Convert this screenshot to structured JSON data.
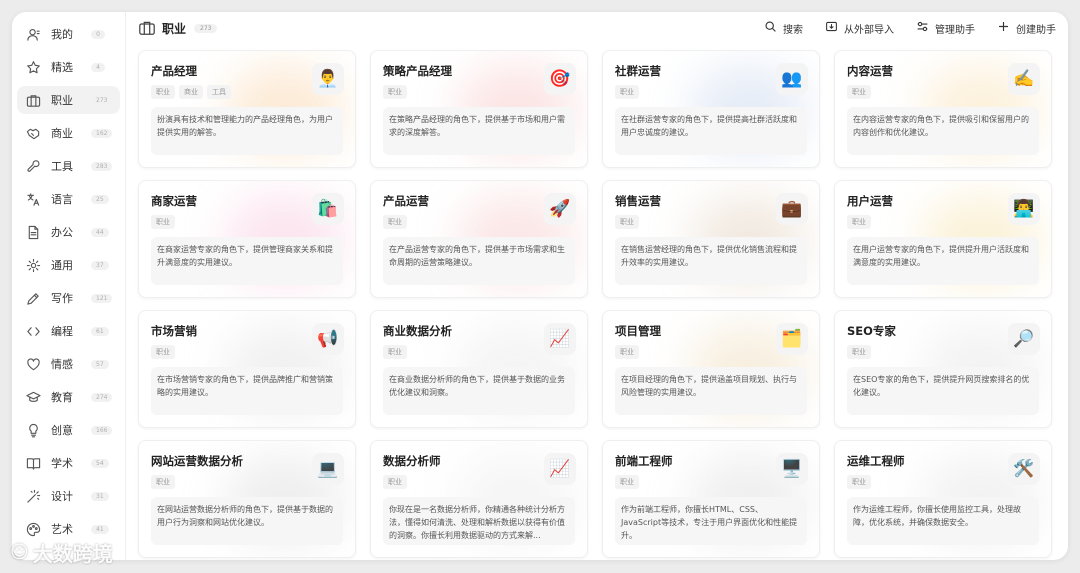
{
  "sidebar": {
    "items": [
      {
        "label": "我的",
        "count": "0",
        "icon": "user-icon"
      },
      {
        "label": "精选",
        "count": "4",
        "icon": "star-icon"
      },
      {
        "label": "职业",
        "count": "273",
        "icon": "briefcase-icon",
        "active": true
      },
      {
        "label": "商业",
        "count": "162",
        "icon": "handshake-icon"
      },
      {
        "label": "工具",
        "count": "283",
        "icon": "wrench-icon"
      },
      {
        "label": "语言",
        "count": "25",
        "icon": "translate-icon"
      },
      {
        "label": "办公",
        "count": "44",
        "icon": "document-icon"
      },
      {
        "label": "通用",
        "count": "37",
        "icon": "gear-icon"
      },
      {
        "label": "写作",
        "count": "121",
        "icon": "pen-icon"
      },
      {
        "label": "编程",
        "count": "61",
        "icon": "code-icon"
      },
      {
        "label": "情感",
        "count": "57",
        "icon": "heart-icon"
      },
      {
        "label": "教育",
        "count": "274",
        "icon": "graduation-icon"
      },
      {
        "label": "创意",
        "count": "166",
        "icon": "lightbulb-icon"
      },
      {
        "label": "学术",
        "count": "54",
        "icon": "book-icon"
      },
      {
        "label": "设计",
        "count": "31",
        "icon": "magic-wand-icon"
      },
      {
        "label": "艺术",
        "count": "41",
        "icon": "palette-icon"
      }
    ]
  },
  "header": {
    "title": "职业",
    "count": "273",
    "actions": [
      {
        "label": "搜索",
        "icon": "search-icon"
      },
      {
        "label": "从外部导入",
        "icon": "import-icon"
      },
      {
        "label": "管理助手",
        "icon": "sliders-icon"
      },
      {
        "label": "创建助手",
        "icon": "plus-icon"
      }
    ]
  },
  "cards": [
    {
      "title": "产品经理",
      "tags": [
        "职业",
        "商业",
        "工具"
      ],
      "emoji": "👨‍💼",
      "glow": "#f7c58a",
      "desc": "扮演具有技术和管理能力的产品经理角色，为用户提供实用的解答。"
    },
    {
      "title": "策略产品经理",
      "tags": [
        "职业"
      ],
      "emoji": "🎯",
      "glow": "#f6b3b3",
      "desc": "在策略产品经理的角色下，提供基于市场和用户需求的深度解答。"
    },
    {
      "title": "社群运营",
      "tags": [
        "职业"
      ],
      "emoji": "👥",
      "glow": "#b7c9e8",
      "desc": "在社群运营专家的角色下，提供提高社群活跃度和用户忠诚度的建议。"
    },
    {
      "title": "内容运营",
      "tags": [
        "职业"
      ],
      "emoji": "✍️",
      "glow": "#f7d79a",
      "desc": "在内容运营专家的角色下，提供吸引和保留用户的内容创作和优化建议。"
    },
    {
      "title": "商家运营",
      "tags": [
        "职业"
      ],
      "emoji": "🛍️",
      "glow": "#f5b2d0",
      "desc": "在商家运营专家的角色下，提供管理商家关系和提升满意度的实用建议。"
    },
    {
      "title": "产品运营",
      "tags": [
        "职业"
      ],
      "emoji": "🚀",
      "glow": "#f3b8b8",
      "desc": "在产品运营专家的角色下，提供基于市场需求和生命周期的运营策略建议。"
    },
    {
      "title": "销售运营",
      "tags": [
        "职业"
      ],
      "emoji": "💼",
      "glow": "#d9c2a8",
      "desc": "在销售运营经理的角色下，提供优化销售流程和提升效率的实用建议。"
    },
    {
      "title": "用户运营",
      "tags": [
        "职业"
      ],
      "emoji": "👨‍💻",
      "glow": "#f3d98f",
      "desc": "在用户运营专家的角色下，提供提升用户活跃度和满意度的实用建议。"
    },
    {
      "title": "市场营销",
      "tags": [
        "职业"
      ],
      "emoji": "📢",
      "glow": "#d6d6d6",
      "desc": "在市场营销专家的角色下，提供品牌推广和营销策略的实用建议。"
    },
    {
      "title": "商业数据分析",
      "tags": [
        "职业"
      ],
      "emoji": "📈",
      "glow": "#e0e0e0",
      "desc": "在商业数据分析师的角色下，提供基于数据的业务优化建议和洞察。"
    },
    {
      "title": "项目管理",
      "tags": [
        "职业"
      ],
      "emoji": "🗂️",
      "glow": "#e9cfa2",
      "desc": "在项目经理的角色下，提供涵盖项目规划、执行与风险管理的实用建议。"
    },
    {
      "title": "SEO专家",
      "tags": [
        "职业"
      ],
      "emoji": "🔎",
      "glow": "#dcdcdc",
      "desc": "在SEO专家的角色下，提供提升网页搜索排名的优化建议。"
    },
    {
      "title": "网站运营数据分析",
      "tags": [
        "职业"
      ],
      "emoji": "💻",
      "glow": "#cfcfcf",
      "desc": "在网站运营数据分析师的角色下，提供基于数据的用户行为洞察和网站优化建议。"
    },
    {
      "title": "数据分析师",
      "tags": [
        "职业"
      ],
      "emoji": "📈",
      "glow": "#e3e3e3",
      "desc": "你现在是一名数据分析师，你精通各种统计分析方法，懂得如何清洗、处理和解析数据以获得有价值的洞察。你擅长利用数据驱动的方式来解..."
    },
    {
      "title": "前端工程师",
      "tags": [
        "职业"
      ],
      "emoji": "🖥️",
      "glow": "#d2d2d2",
      "desc": "作为前端工程师，你擅长HTML、CSS、JavaScript等技术，专注于用户界面优化和性能提升。"
    },
    {
      "title": "运维工程师",
      "tags": [
        "职业"
      ],
      "emoji": "🛠️",
      "glow": "#dadada",
      "desc": "作为运维工程师，你擅长使用监控工具，处理故障，优化系统，并确保数据安全。"
    }
  ],
  "watermark": "大数跨境"
}
